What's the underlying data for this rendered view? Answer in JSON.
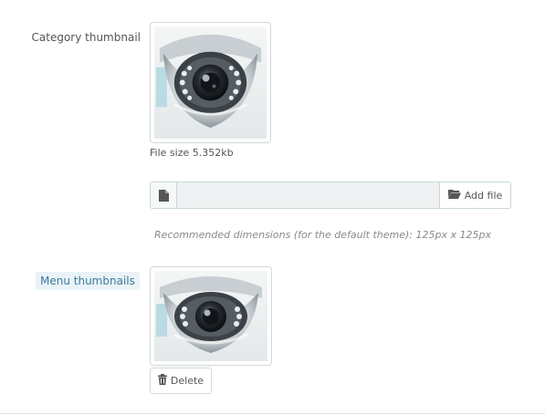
{
  "category_thumbnail": {
    "label": "Category thumbnail",
    "image_alt": "dome security camera",
    "file_size_text": "File size 5.352kb"
  },
  "file_upload": {
    "value": "",
    "icon": "file-icon",
    "add_file_label": "Add file",
    "add_file_icon": "folder-open-icon",
    "help_text": "Recommended dimensions (for the default theme): 125px x 125px"
  },
  "menu_thumbnails": {
    "label": "Menu thumbnails",
    "image_alt": "dome security camera",
    "delete_label": "Delete",
    "delete_icon": "trash-icon"
  },
  "colors": {
    "accent_label_bg": "#eaf3f7",
    "accent_label_text": "#3c7a9c",
    "border": "#c7d6db"
  }
}
